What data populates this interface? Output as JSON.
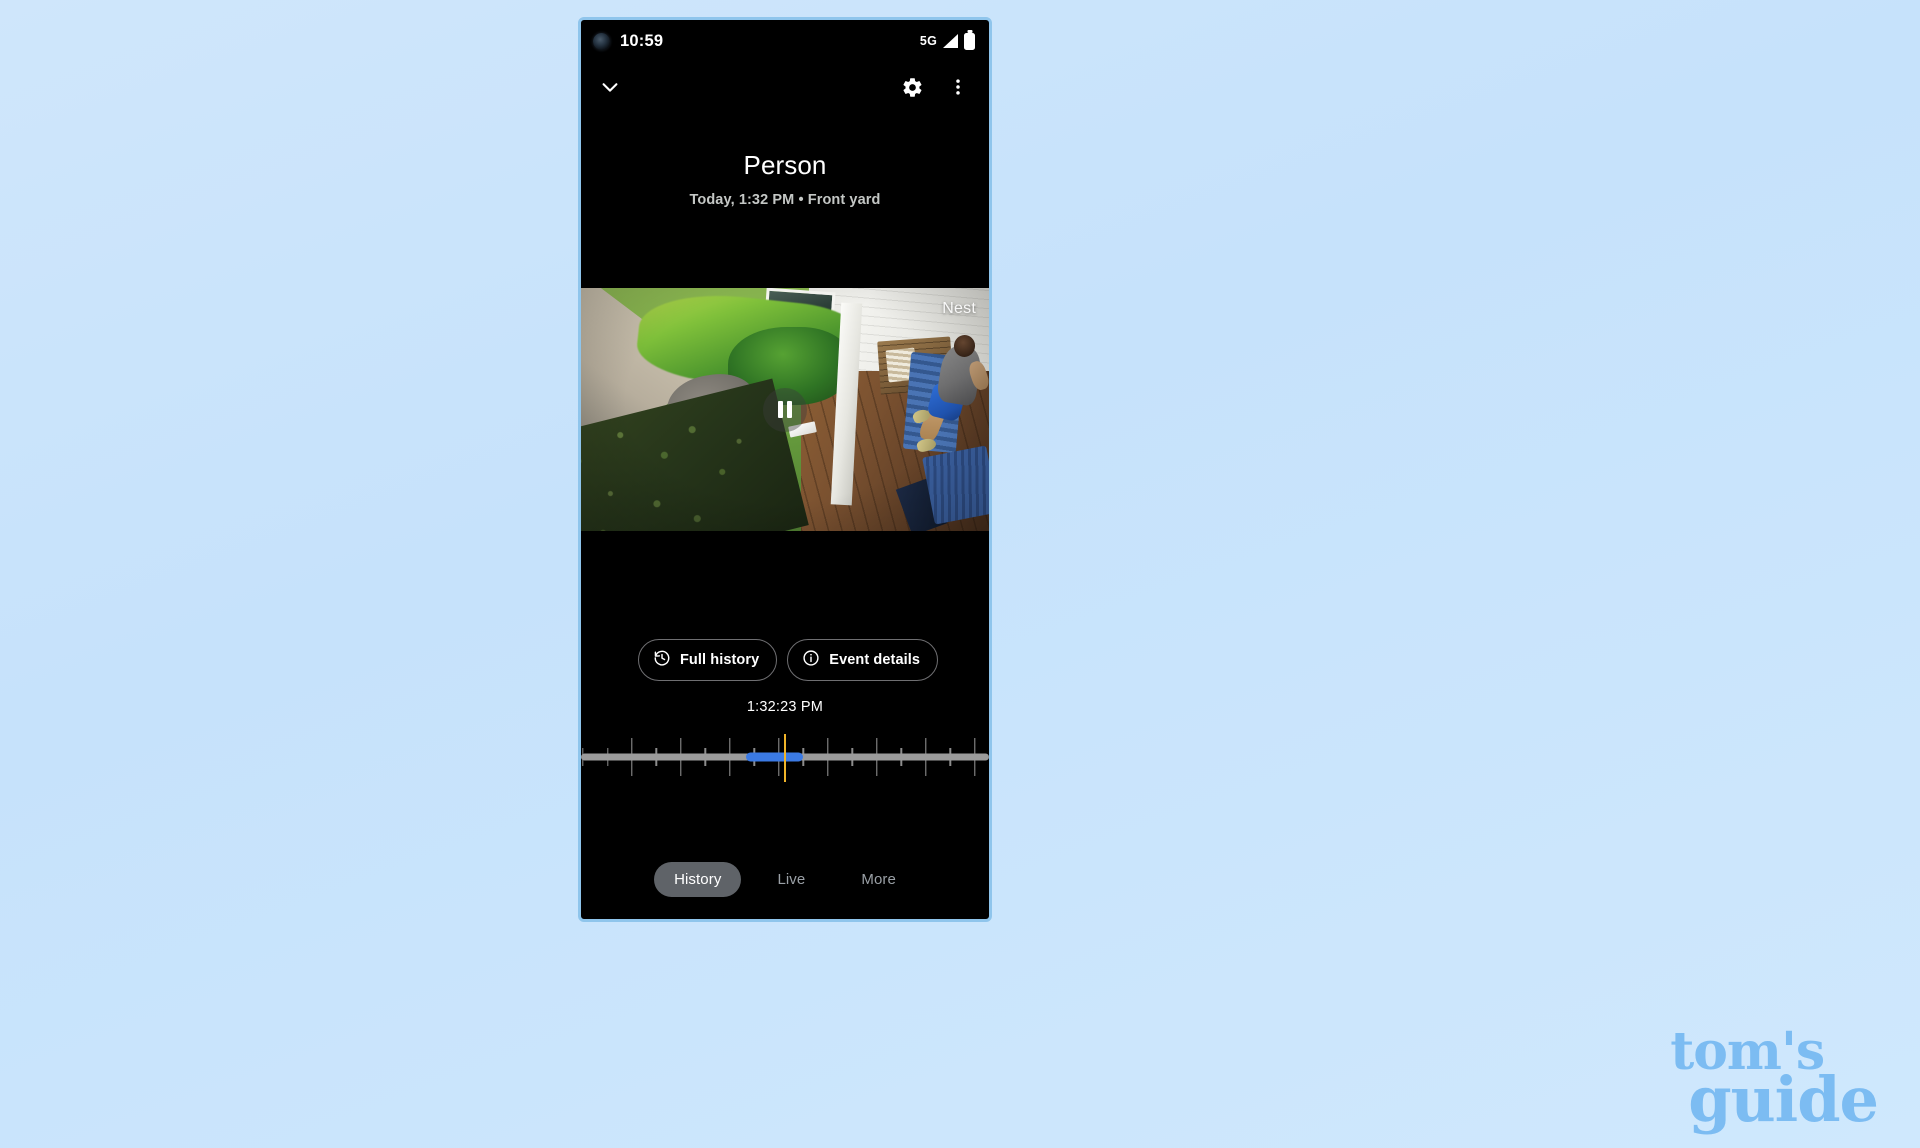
{
  "background": {
    "color_start": "#cfe6fb",
    "color_end": "#cfe8fd"
  },
  "watermark": {
    "line1": "tom's",
    "line2": "guide",
    "color": "#7cbcf2"
  },
  "phone": {
    "status_bar": {
      "time": "10:59",
      "network": "5G",
      "signal_icon": "signal-bars-icon",
      "battery_icon": "battery-full-icon",
      "camera_icon": "front-camera-punchhole-icon"
    },
    "app_bar": {
      "collapse_icon": "chevron-down-icon",
      "settings_icon": "gear-icon",
      "overflow_icon": "kebab-menu-icon"
    },
    "event": {
      "title": "Person",
      "subtitle": "Today, 1:32 PM • Front yard"
    },
    "video": {
      "watermark": "Nest",
      "playback_state_icon": "pause-icon"
    },
    "actions": [
      {
        "label": "Full history",
        "icon": "history-clock-icon"
      },
      {
        "label": "Event details",
        "icon": "info-circle-icon"
      }
    ],
    "timeline": {
      "current_time": "1:32:23 PM",
      "playhead_percent": 50,
      "playhead_color": "#f0b429",
      "track_color": "#9b9b9b",
      "segment_color": "#3b7ae4",
      "segment_start_percent": 40.5,
      "segment_end_percent": 54.5,
      "major_ticks_percent": [
        12.5,
        24.5,
        36.5,
        48.5,
        60.5,
        72.5,
        84.5,
        96.5
      ],
      "minor_ticks_percent": [
        0.5,
        6.5,
        18.5,
        30.5,
        42.5,
        54.5,
        66.5,
        78.5,
        90.5
      ]
    },
    "tabs": [
      {
        "label": "History",
        "active": true
      },
      {
        "label": "Live",
        "active": false
      },
      {
        "label": "More",
        "active": false
      }
    ]
  }
}
